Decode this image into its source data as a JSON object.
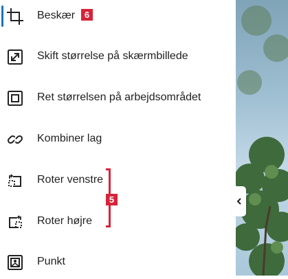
{
  "menu": {
    "items": [
      {
        "label": "Beskær",
        "icon": "crop-icon",
        "active": true,
        "badge": "6"
      },
      {
        "label": "Skift størrelse på skærmbillede",
        "icon": "resize-image-icon"
      },
      {
        "label": "Ret størrelsen på arbejdsområdet",
        "icon": "canvas-size-icon"
      },
      {
        "label": "Kombiner lag",
        "icon": "merge-layers-icon"
      },
      {
        "label": "Roter venstre",
        "icon": "rotate-left-icon"
      },
      {
        "label": "Roter højre",
        "icon": "rotate-right-icon"
      },
      {
        "label": "Punkt",
        "icon": "image-point-icon"
      }
    ],
    "group_annotation": {
      "label": "5"
    }
  },
  "collapse_button": {
    "icon": "chevron-left-icon"
  },
  "colors": {
    "accent": "#1a73b8",
    "annotation": "#d6243a",
    "text": "#1f1f1f"
  }
}
